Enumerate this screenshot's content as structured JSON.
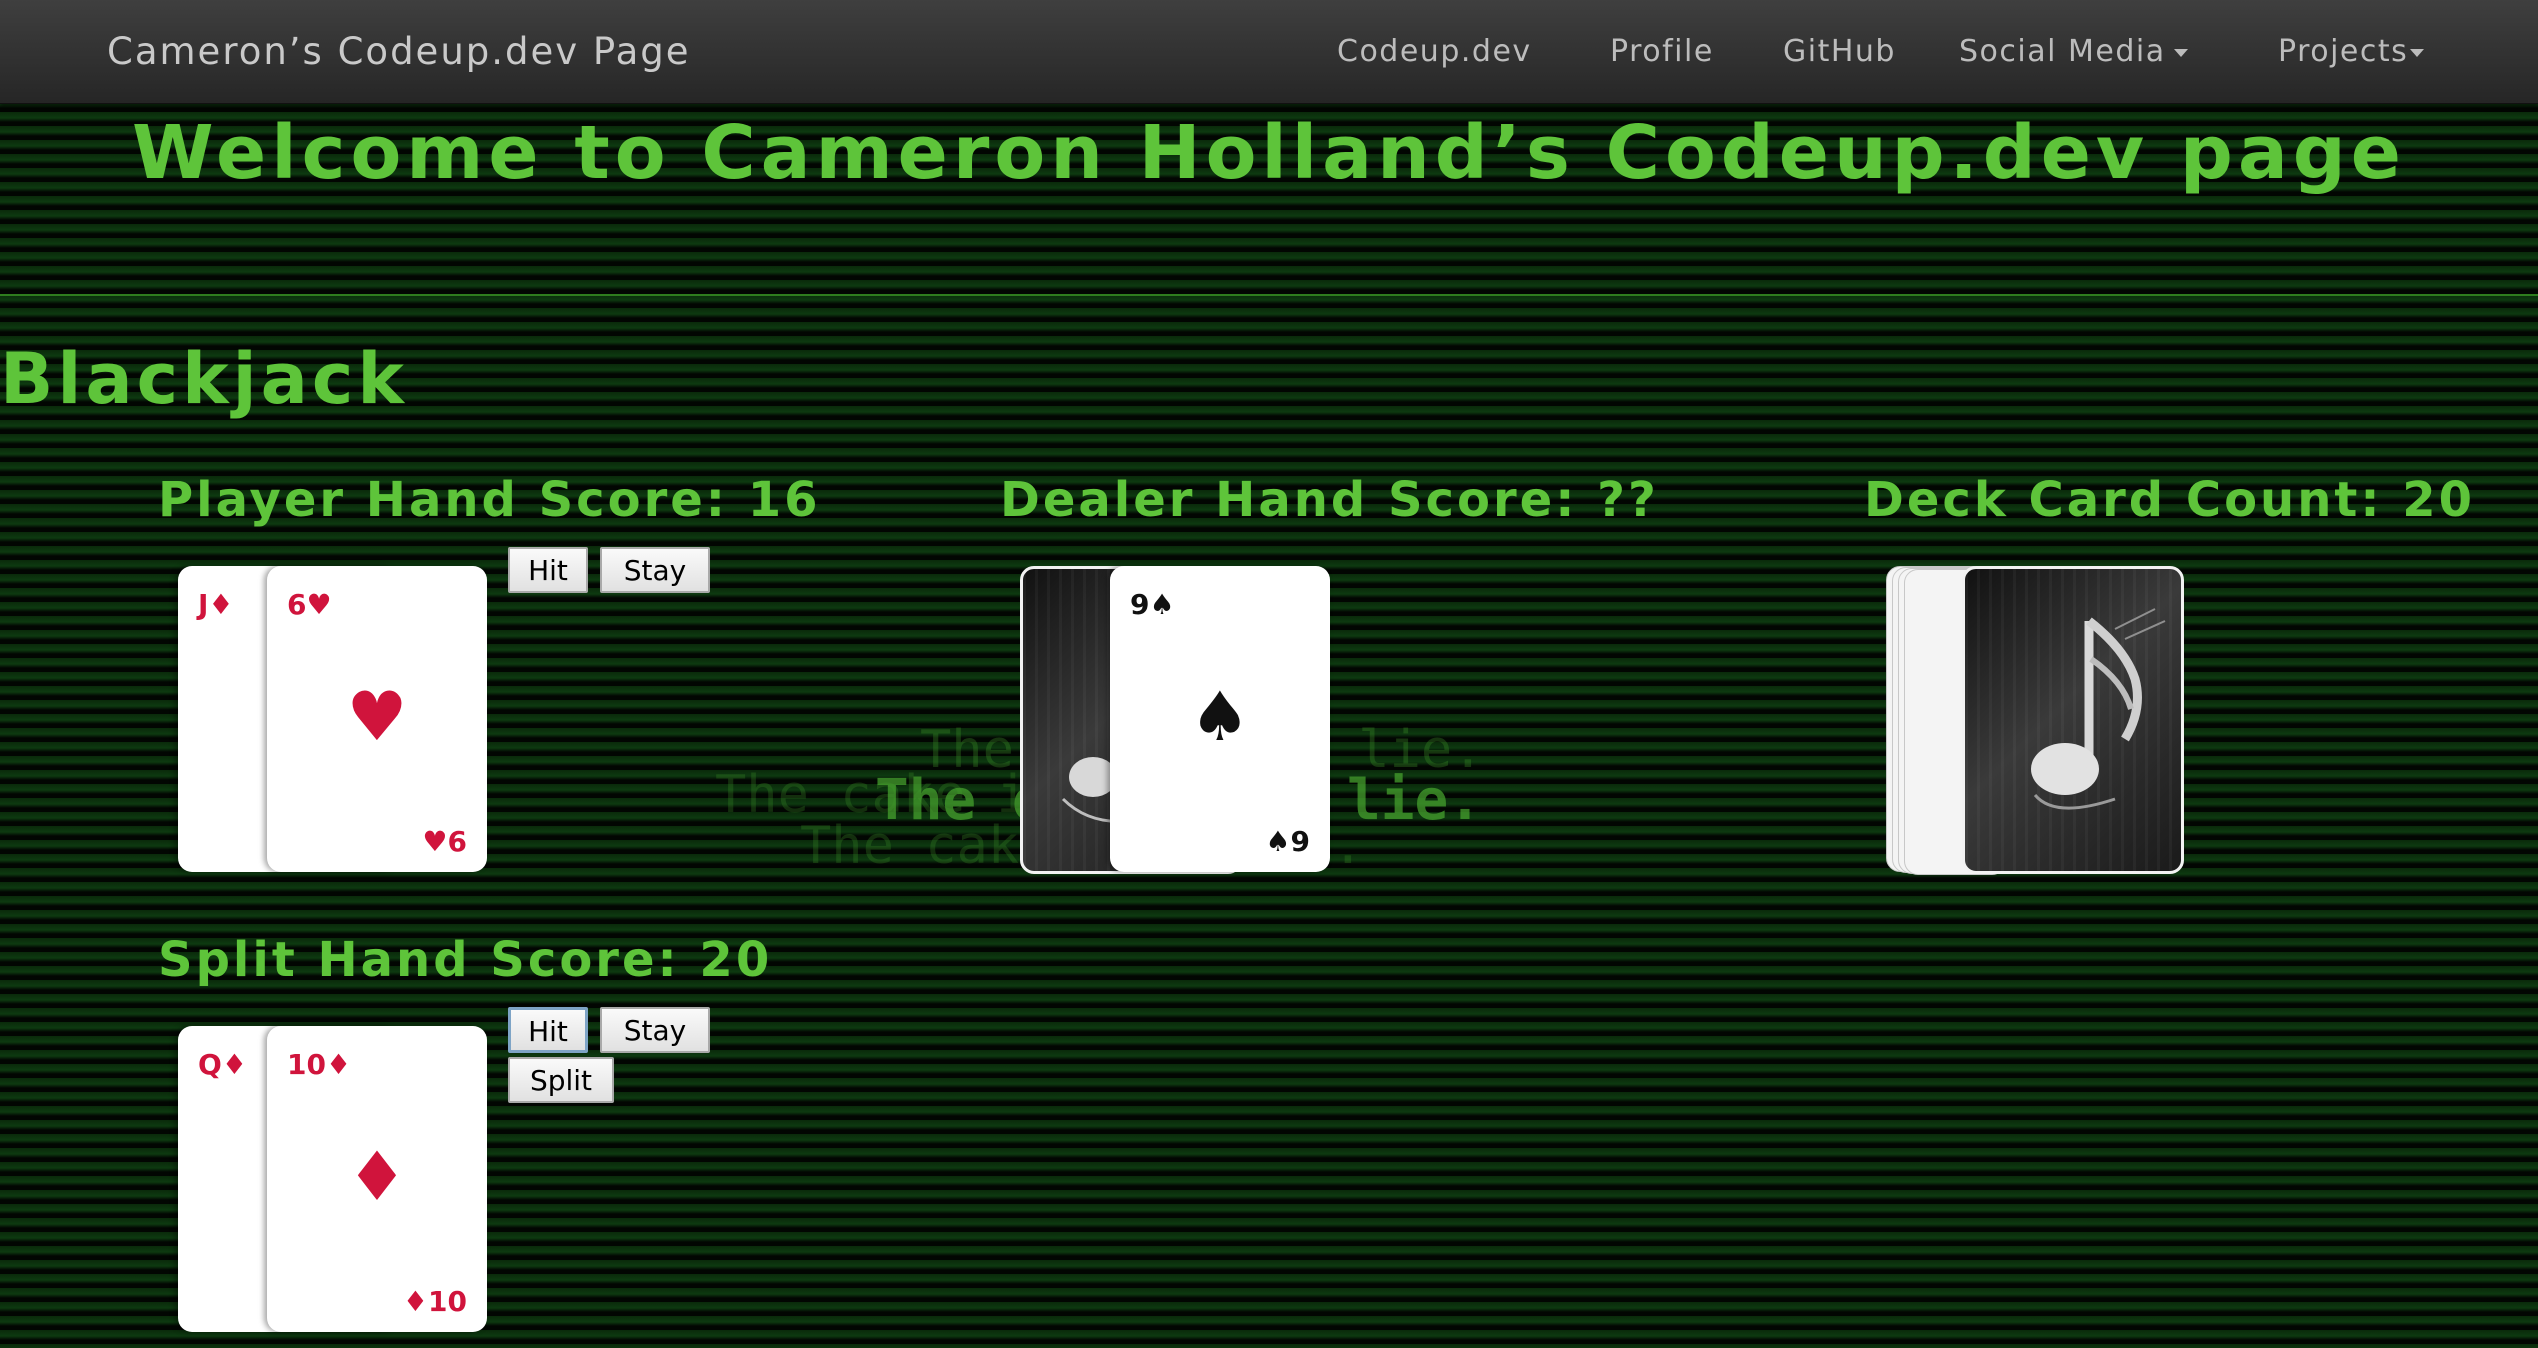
{
  "navbar": {
    "brand": "Cameron’s Codeup.dev Page",
    "links": [
      {
        "label": "Codeup.dev"
      },
      {
        "label": "Profile"
      },
      {
        "label": "GitHub"
      },
      {
        "label": "Social Media"
      },
      {
        "label": "Projects"
      }
    ]
  },
  "page": {
    "welcome": "Welcome to Cameron Holland’s Codeup.dev page",
    "section_title": "Blackjack",
    "background_text": [
      "The cake is a lie.",
      "The cake is a lie.",
      "The cake is a lie.",
      "The cake is a lie."
    ]
  },
  "player": {
    "score_label": "Player Hand Score: 16",
    "cards": [
      {
        "rank": "J",
        "suit": "♦",
        "color": "#d0143c"
      },
      {
        "rank": "6",
        "suit": "♥",
        "color": "#d0143c"
      }
    ],
    "buttons": {
      "hit": "Hit",
      "stay": "Stay"
    }
  },
  "dealer": {
    "score_label": "Dealer Hand Score: ??",
    "cards": [
      {
        "rank": "hidden",
        "suit": "",
        "color": "#111111"
      },
      {
        "rank": "9",
        "suit": "♠",
        "color": "#111111"
      }
    ]
  },
  "deck": {
    "count_label": "Deck Card Count: 20",
    "back_icon": "music-note-icon"
  },
  "split": {
    "score_label": "Split Hand Score: 20",
    "cards": [
      {
        "rank": "Q",
        "suit": "♦",
        "color": "#d0143c"
      },
      {
        "rank": "10",
        "suit": "♦",
        "color": "#d0143c"
      }
    ],
    "buttons": {
      "hit": "Hit",
      "stay": "Stay",
      "split": "Split"
    }
  },
  "colors": {
    "accent_green": "#5ec43a",
    "card_red": "#d0143c",
    "navbar_bg": "#2e2e2e"
  }
}
